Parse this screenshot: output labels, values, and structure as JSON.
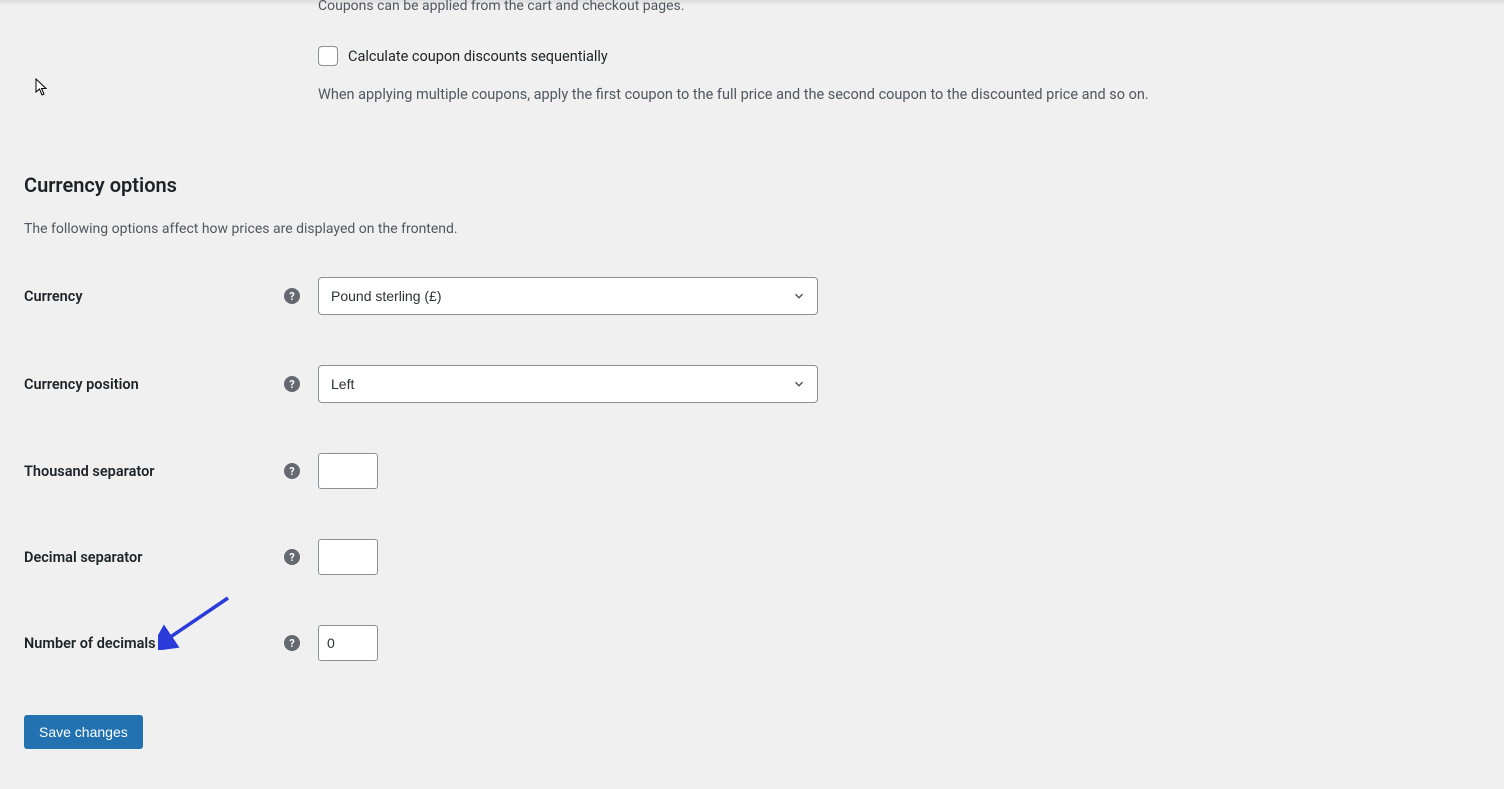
{
  "coupons": {
    "top_desc": "Coupons can be applied from the cart and checkout pages.",
    "sequential_label": "Calculate coupon discounts sequentially",
    "sequential_desc": "When applying multiple coupons, apply the first coupon to the full price and the second coupon to the discounted price and so on."
  },
  "currency": {
    "heading": "Currency options",
    "desc": "The following options affect how prices are displayed on the frontend.",
    "rows": {
      "currency": {
        "label": "Currency",
        "value": "Pound sterling (£)"
      },
      "position": {
        "label": "Currency position",
        "value": "Left"
      },
      "thousand": {
        "label": "Thousand separator",
        "value": ""
      },
      "decimal": {
        "label": "Decimal separator",
        "value": ""
      },
      "decimals": {
        "label": "Number of decimals",
        "value": "0"
      }
    }
  },
  "actions": {
    "save": "Save changes"
  }
}
